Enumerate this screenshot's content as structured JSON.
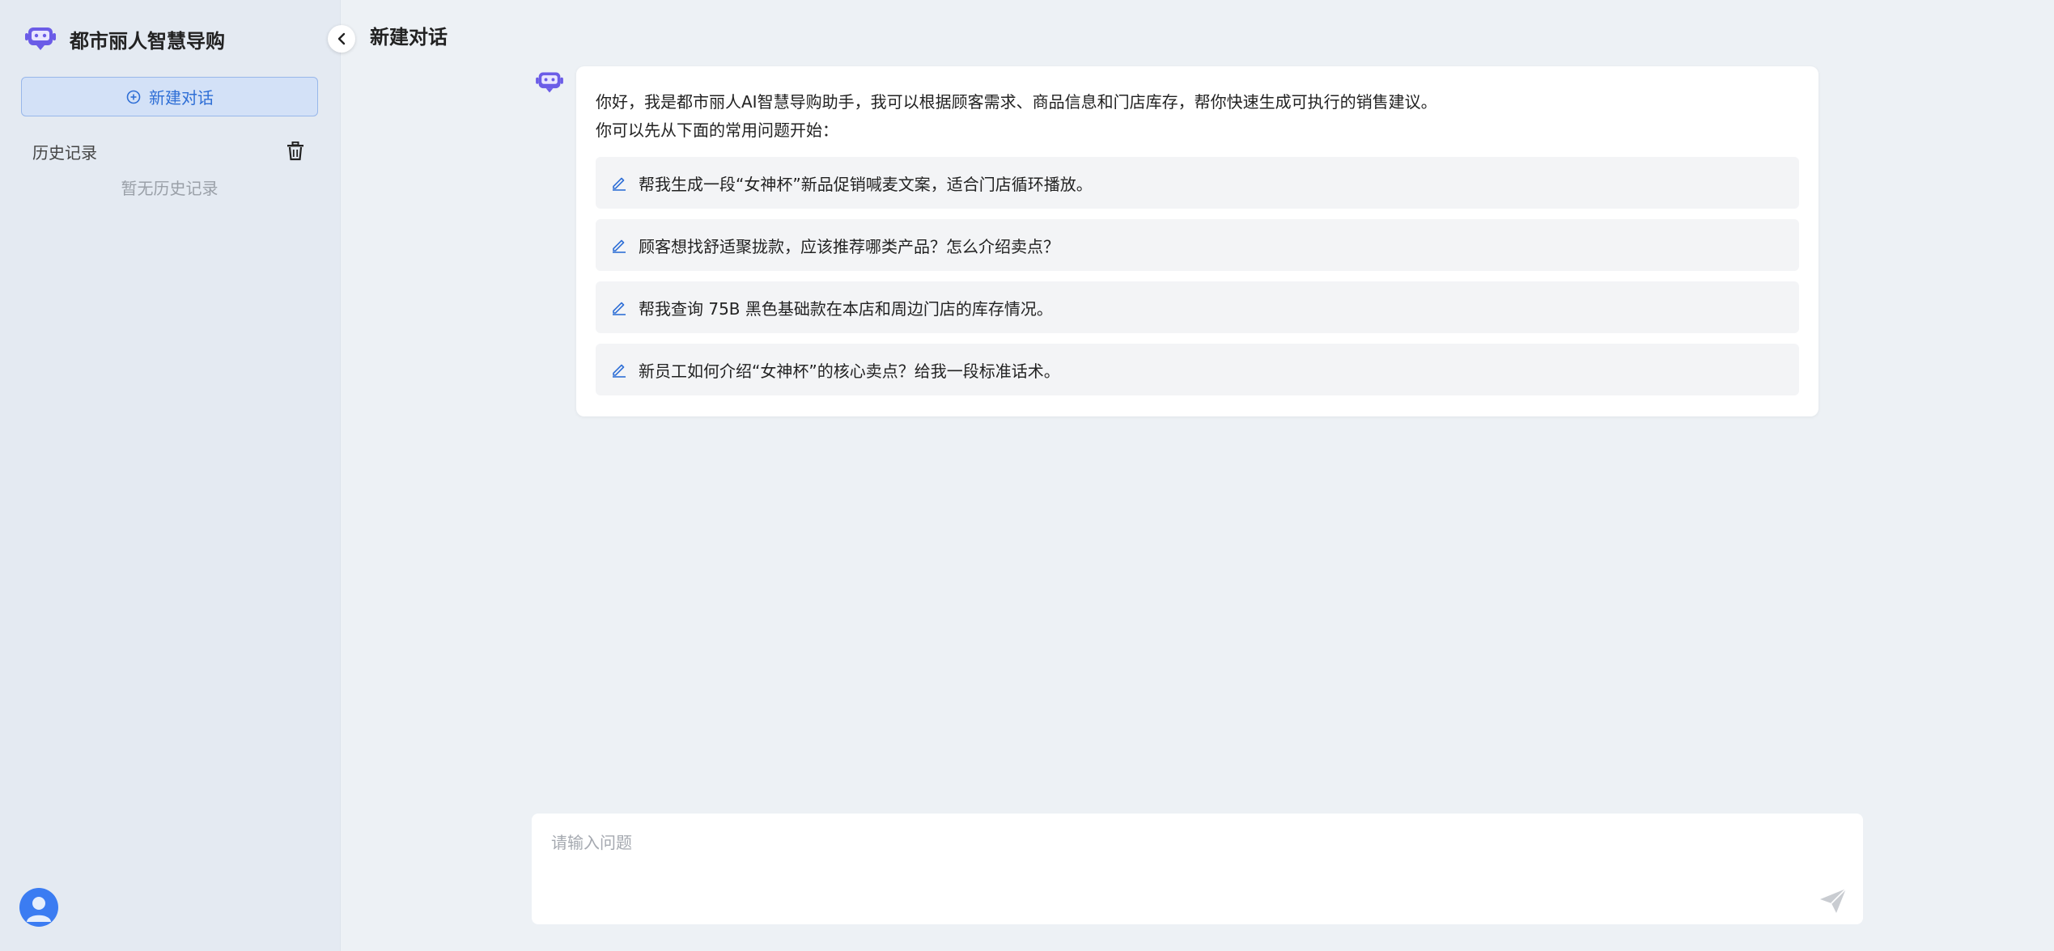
{
  "sidebar": {
    "brand_title": "都市丽人智慧导购",
    "new_chat_label": "新建对话",
    "history_label": "历史记录",
    "history_empty": "暂无历史记录"
  },
  "main": {
    "title": "新建对话",
    "greeting": {
      "line1": "你好，我是都市丽人AI智慧导购助手，我可以根据顾客需求、商品信息和门店库存，帮你快速生成可执行的销售建议。",
      "line2": "你可以先从下面的常用问题开始："
    },
    "suggestions": [
      "帮我生成一段“女神杯”新品促销喊麦文案，适合门店循环播放。",
      "顾客想找舒适聚拢款，应该推荐哪类产品？怎么介绍卖点？",
      "帮我查询 75B 黑色基础款在本店和周边门店的库存情况。",
      "新员工如何介绍“女神杯”的核心卖点？给我一段标准话术。"
    ]
  },
  "input": {
    "placeholder": "请输入问题",
    "value": ""
  },
  "icons": {
    "brand": "robot-icon",
    "new_chat": "plus-circle-icon",
    "history_clear": "trash-icon",
    "collapse": "chevron-left-icon",
    "suggestion": "edit-icon",
    "send": "send-icon",
    "user": "user-avatar-icon"
  },
  "colors": {
    "accent": "#2f6fd6",
    "robot": "#6b5ce7",
    "sidebar_bg": "#e4eaf2",
    "main_bg": "#edf1f5"
  }
}
